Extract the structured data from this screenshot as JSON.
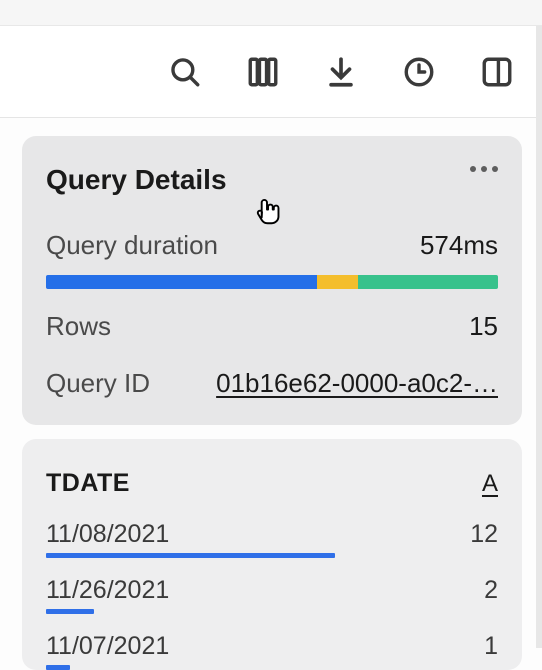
{
  "toolbar": {
    "icons": [
      "search-icon",
      "columns-icon",
      "download-icon",
      "clock-icon",
      "panel-icon"
    ]
  },
  "details": {
    "title": "Query Details",
    "duration_label": "Query duration",
    "duration_value": "574ms",
    "bar_segments": [
      {
        "color": "#256fe8",
        "pct": 60
      },
      {
        "color": "#f4be2c",
        "pct": 9
      },
      {
        "color": "#38c28c",
        "pct": 31
      }
    ],
    "rows_label": "Rows",
    "rows_value": "15",
    "query_id_label": "Query ID",
    "query_id_value": "01b16e62-0000-a0c2-…"
  },
  "column": {
    "name": "TDATE",
    "type_glyph": "A",
    "max_count": 15,
    "rows": [
      {
        "date": "11/08/2021",
        "count": 12
      },
      {
        "date": "11/26/2021",
        "count": 2
      },
      {
        "date": "11/07/2021",
        "count": 1
      }
    ]
  }
}
